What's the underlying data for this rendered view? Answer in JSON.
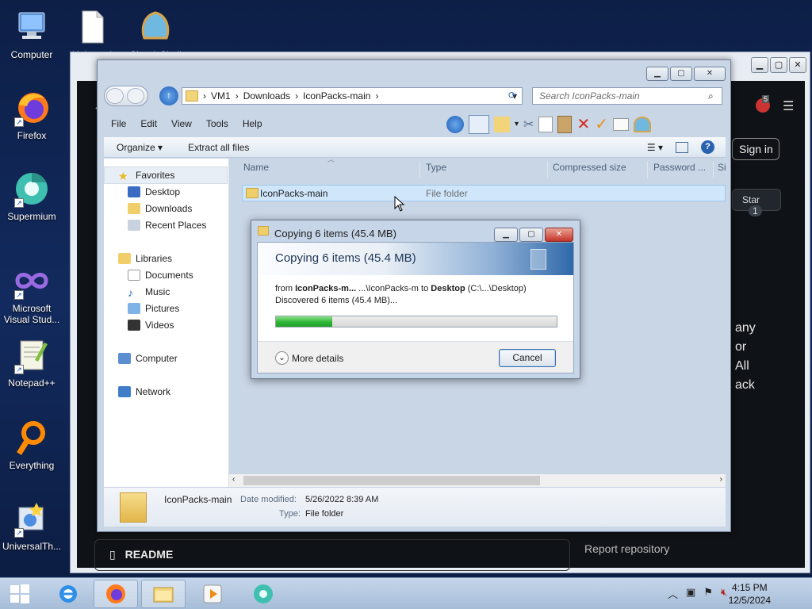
{
  "desktop": {
    "icons": [
      {
        "label": "Computer",
        "icon": "computer-icon"
      },
      {
        "label": "Universal",
        "icon": "document-icon"
      },
      {
        "label": "ClassicShell",
        "icon": "shell-icon"
      },
      {
        "label": "Firefox",
        "icon": "firefox-icon"
      },
      {
        "label": "Supermium",
        "icon": "supermium-icon"
      },
      {
        "label": "Microsoft Visual Stud...",
        "icon": "visual-studio-icon"
      },
      {
        "label": "Notepad++",
        "icon": "notepadpp-icon"
      },
      {
        "label": "Everything",
        "icon": "everything-icon"
      },
      {
        "label": "UniversalTh...",
        "icon": "universal-theme-icon"
      }
    ]
  },
  "browser": {
    "sign_in": "Sign in",
    "star_label": "Star",
    "star_count": "1",
    "fragments": [
      "any",
      "or",
      "All",
      "ack"
    ],
    "readme": "README",
    "report": "Report repository",
    "badge": "5"
  },
  "explorer": {
    "address": {
      "segments": [
        "VM1",
        "Downloads",
        "IconPacks-main"
      ]
    },
    "search_placeholder": "Search IconPacks-main",
    "menu": [
      "File",
      "Edit",
      "View",
      "Tools",
      "Help"
    ],
    "commands": {
      "organize": "Organize",
      "extract": "Extract all files"
    },
    "nav": {
      "favorites": "Favorites",
      "desktop": "Desktop",
      "downloads": "Downloads",
      "recent": "Recent Places",
      "libraries": "Libraries",
      "documents": "Documents",
      "music": "Music",
      "pictures": "Pictures",
      "videos": "Videos",
      "computer": "Computer",
      "network": "Network"
    },
    "columns": [
      "Name",
      "Type",
      "Compressed size",
      "Password ...",
      "Si"
    ],
    "rows": [
      {
        "name": "IconPacks-main",
        "type": "File folder"
      }
    ],
    "details": {
      "name": "IconPacks-main",
      "modified_label": "Date modified:",
      "modified_value": "5/26/2022 8:39 AM",
      "type_label": "Type:",
      "type_value": "File folder"
    }
  },
  "copy_dialog": {
    "title": "Copying 6 items (45.4 MB)",
    "header": "Copying 6 items (45.4 MB)",
    "from_prefix": "from",
    "from_name": "IconPacks-m...",
    "from_path": "...\\IconPacks-m",
    "to_word": "to",
    "to_name": "Desktop",
    "to_path": "(C:\\...\\Desktop)",
    "discovered": "Discovered 6 items (45.4 MB)...",
    "progress": 0.2,
    "more_details": "More details",
    "cancel": "Cancel"
  },
  "taskbar": {
    "time": "4:15 PM",
    "date": "12/5/2024"
  }
}
